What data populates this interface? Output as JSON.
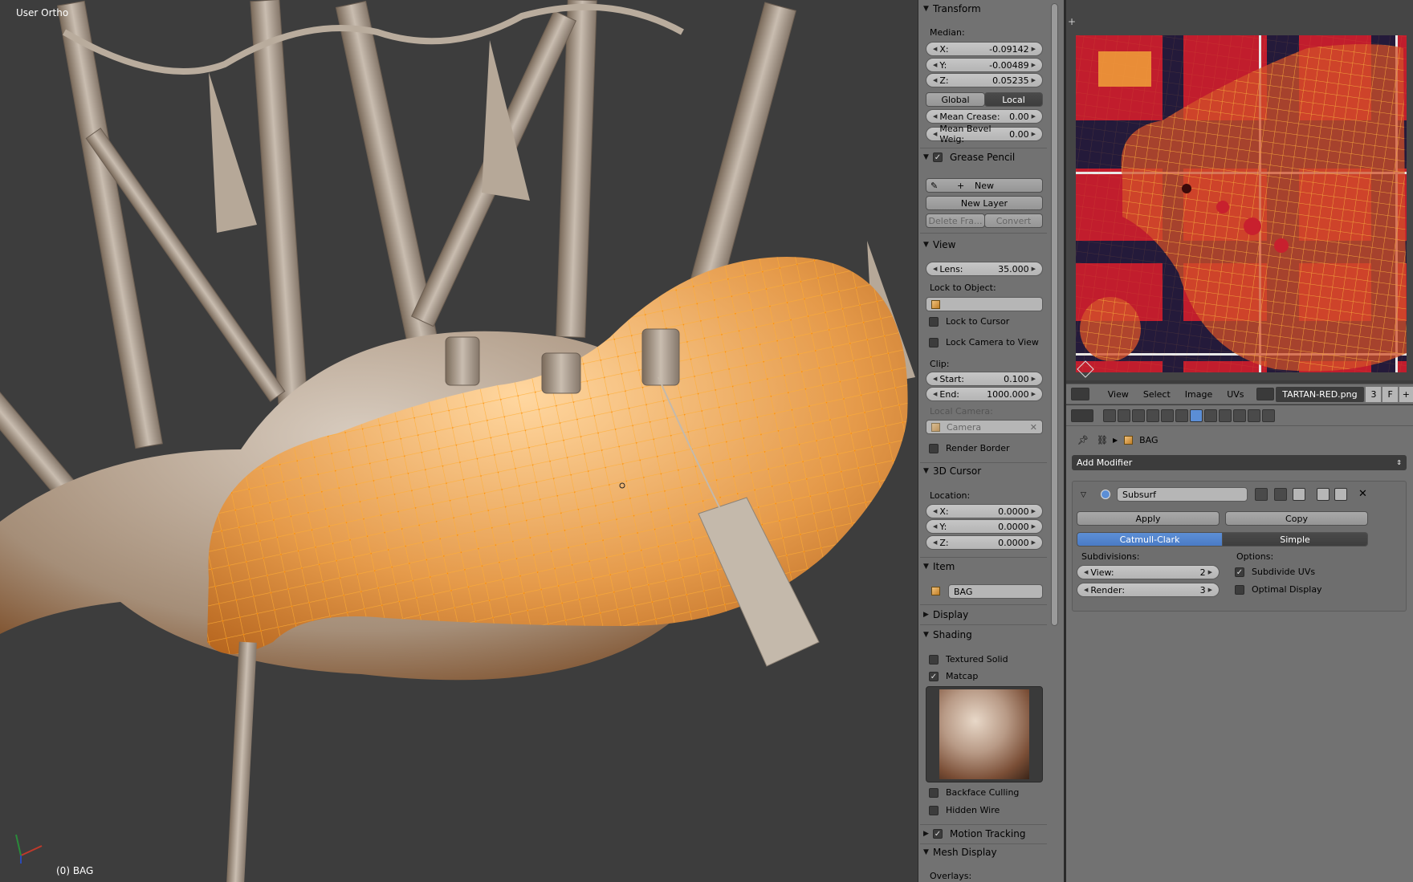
{
  "viewport": {
    "view_label": "User Ortho",
    "object_label": "(0) BAG"
  },
  "npanel": {
    "transform": {
      "header": "Transform",
      "median_label": "Median:",
      "x_key": "X:",
      "x_val": "-0.09142",
      "y_key": "Y:",
      "y_val": "-0.00489",
      "z_key": "Z:",
      "z_val": "0.05235",
      "global_label": "Global",
      "local_label": "Local",
      "crease_key": "Mean Crease:",
      "crease_val": "0.00",
      "bevel_key": "Mean Bevel Weig:",
      "bevel_val": "0.00"
    },
    "grease_pencil": {
      "header": "Grease Pencil",
      "new_label": "New",
      "new_layer_label": "New Layer",
      "delete_frame_label": "Delete Fra...",
      "convert_label": "Convert"
    },
    "view": {
      "header": "View",
      "lens_key": "Lens:",
      "lens_val": "35.000",
      "lock_object_label": "Lock to Object:",
      "lock_cursor_label": "Lock to Cursor",
      "lock_camera_label": "Lock Camera to View",
      "clip_label": "Clip:",
      "start_key": "Start:",
      "start_val": "0.100",
      "end_key": "End:",
      "end_val": "1000.000",
      "local_camera_label": "Local Camera:",
      "camera_placeholder": "Camera",
      "render_border_label": "Render Border"
    },
    "cursor": {
      "header": "3D Cursor",
      "location_label": "Location:",
      "x_key": "X:",
      "x_val": "0.0000",
      "y_key": "Y:",
      "y_val": "0.0000",
      "z_key": "Z:",
      "z_val": "0.0000"
    },
    "item": {
      "header": "Item",
      "name": "BAG"
    },
    "display": {
      "header": "Display"
    },
    "shading": {
      "header": "Shading",
      "textured_solid_label": "Textured Solid",
      "matcap_label": "Matcap",
      "backface_label": "Backface Culling",
      "hidden_wire_label": "Hidden Wire"
    },
    "motion_tracking": {
      "header": "Motion Tracking"
    },
    "mesh_display": {
      "header": "Mesh Display",
      "overlays_label": "Overlays:"
    }
  },
  "uv_header": {
    "menus": [
      "View",
      "Select",
      "Image",
      "UVs"
    ],
    "image_name": "TARTAN-RED.png",
    "users": "3",
    "fake_user": "F"
  },
  "properties": {
    "object_name": "BAG",
    "add_modifier_label": "Add Modifier",
    "modifier_name": "Subsurf",
    "apply_label": "Apply",
    "copy_label": "Copy",
    "catmull_label": "Catmull-Clark",
    "simple_label": "Simple",
    "subdivisions_label": "Subdivisions:",
    "view_key": "View:",
    "view_val": "2",
    "render_key": "Render:",
    "render_val": "3",
    "options_label": "Options:",
    "subdivide_uvs_label": "Subdivide UVs",
    "optimal_display_label": "Optimal Display"
  },
  "colors": {
    "accent": "#5b8ed6",
    "selection_orange": "#f39a2a",
    "tartan_red": "#c8202e",
    "panel_bg": "#727272",
    "viewport_bg": "#3d3d3d"
  }
}
